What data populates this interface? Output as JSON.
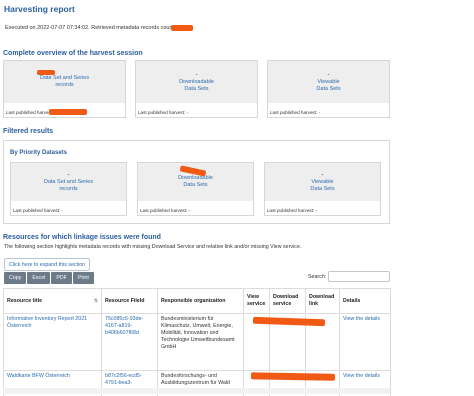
{
  "page": {
    "title": "Harvesting report",
    "exec_text": "Executed on 2022-07-07 07:34:02. Retrieved metadata records count:"
  },
  "overview": {
    "heading": "Complete overview of the harvest session",
    "cards": [
      {
        "value": "",
        "label_line1": "Data Set and Series",
        "label_line2": "records",
        "footer": "Last published harvest:"
      },
      {
        "value": "-",
        "label_line1": "Downloadable",
        "label_line2": "Data Sets",
        "footer": "Last published harvest: -"
      },
      {
        "value": "-",
        "label_line1": "Viewable",
        "label_line2": "Data Sets",
        "footer": "Last published harvest: -"
      }
    ]
  },
  "filtered": {
    "heading": "Filtered results",
    "subheading": "By Priority Datasets",
    "cards": [
      {
        "value": "-",
        "label_line1": "Data Set and Series",
        "label_line2": "records",
        "footer": "Last published harvest: -"
      },
      {
        "value": "",
        "label_line1": "Downloadable",
        "label_line2": "Data Sets",
        "footer": "Last published harvest: -"
      },
      {
        "value": "-",
        "label_line1": "Viewable",
        "label_line2": "Data Sets",
        "footer": "Last published harvest: -"
      }
    ]
  },
  "issues": {
    "heading": "Resources for which linkage issues were found",
    "intro": "The following section highlights metadata records with missing Download Service and relative link and/or missing View service.",
    "expand_label": "Click here to expand this section",
    "buttons": [
      "Copy",
      "Excel",
      "PDF",
      "Print"
    ],
    "search_label": "Search:",
    "search_value": "",
    "columns": [
      "Resource title",
      "Resource FileId",
      "Responsible organization",
      "View service",
      "Download service",
      "Download link",
      "Details"
    ],
    "sort_icon": "sort-icon",
    "rows": [
      {
        "title": "Informative Inventory Report 2021 Österreich",
        "fileid": "75c085c6-93de-4167-a819-b406b607f68d",
        "org": "Bundesministerium für Klimaschutz, Umwelt, Energie, Mobilität, Innovation und Technologie Umweltbundesamt GmbH",
        "details": "View the details"
      },
      {
        "title": "Waldkarte BFW Österreich",
        "fileid": "b87c2f56-ecd5-4791-bea3-",
        "org": "Bundesforschungs- und Ausbildungszentrum für Wald",
        "details": "View the details"
      }
    ]
  },
  "colors": {
    "heading": "#2a5f9e",
    "link": "#2a6cb0",
    "redaction": "#f05a14",
    "card_bg": "#eeeeee",
    "button_bg": "#6c7a89"
  }
}
